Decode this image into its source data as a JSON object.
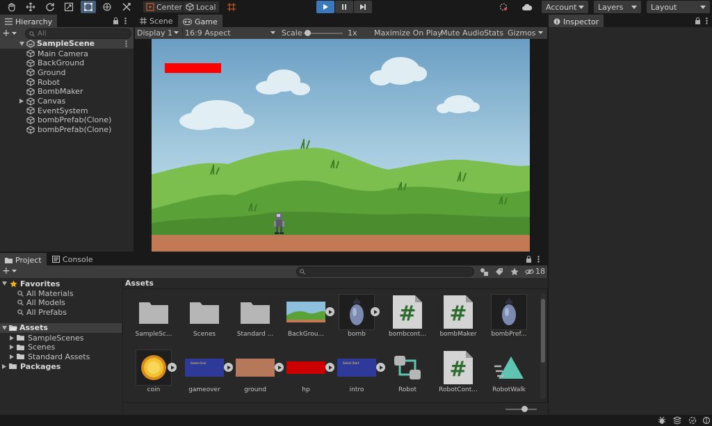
{
  "toolbar": {
    "center_label": "Center",
    "local_label": "Local",
    "account_label": "Account",
    "layers_label": "Layers",
    "layout_label": "Layout"
  },
  "hierarchy": {
    "tab_label": "Hierarchy",
    "search_placeholder": "All",
    "scene_name": "SampleScene",
    "items": [
      {
        "label": "Main Camera"
      },
      {
        "label": "BackGround"
      },
      {
        "label": "Ground"
      },
      {
        "label": "Robot"
      },
      {
        "label": "BombMaker"
      },
      {
        "label": "Canvas"
      },
      {
        "label": "EventSystem"
      },
      {
        "label": "bombPrefab(Clone)"
      },
      {
        "label": "bombPrefab(Clone)"
      }
    ]
  },
  "game_view": {
    "scene_tab": "Scene",
    "game_tab": "Game",
    "display": "Display 1",
    "aspect": "16:9 Aspect",
    "scale_label": "Scale",
    "scale_value": "1x",
    "scale_fraction": 0.1,
    "maximize": "Maximize On Play",
    "mute": "Mute Audio",
    "stats": "Stats",
    "gizmos": "Gizmos",
    "hp_color": "#ff0000"
  },
  "inspector": {
    "tab_label": "Inspector"
  },
  "project": {
    "project_tab": "Project",
    "console_tab": "Console",
    "hidden_count": "18",
    "favorites_label": "Favorites",
    "favorites": [
      {
        "label": "All Materials"
      },
      {
        "label": "All Models"
      },
      {
        "label": "All Prefabs"
      }
    ],
    "assets_label": "Assets",
    "asset_folders": [
      {
        "label": "SampleScenes"
      },
      {
        "label": "Scenes"
      },
      {
        "label": "Standard Assets"
      }
    ],
    "packages_label": "Packages",
    "breadcrumb": "Assets",
    "grid": [
      {
        "label": "SampleSc...",
        "kind": "folder"
      },
      {
        "label": "Scenes",
        "kind": "folder"
      },
      {
        "label": "Standard ...",
        "kind": "folder"
      },
      {
        "label": "BackGrou...",
        "kind": "image"
      },
      {
        "label": "bomb",
        "kind": "sprite"
      },
      {
        "label": "bombcont...",
        "kind": "script"
      },
      {
        "label": "bombMaker",
        "kind": "script"
      },
      {
        "label": "bombPref...",
        "kind": "prefab"
      },
      {
        "label": "coin",
        "kind": "sprite"
      },
      {
        "label": "gameover",
        "kind": "image"
      },
      {
        "label": "ground",
        "kind": "image"
      },
      {
        "label": "hp",
        "kind": "image"
      },
      {
        "label": "intro",
        "kind": "image"
      },
      {
        "label": "Robot",
        "kind": "animator"
      },
      {
        "label": "RobotCont...",
        "kind": "script"
      },
      {
        "label": "RobotWalk",
        "kind": "animation"
      }
    ],
    "gameover_thumb_text": "Game Over",
    "intro_thumb_text": "Select Start",
    "size_slider_fraction": 0.6
  }
}
